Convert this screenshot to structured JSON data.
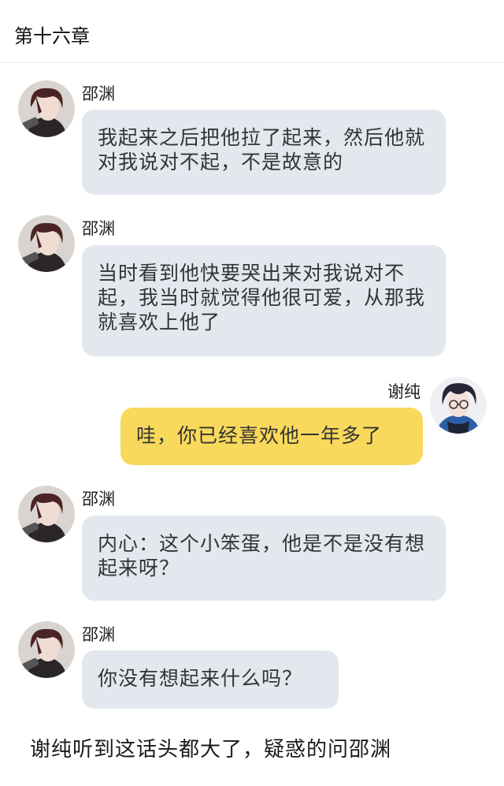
{
  "header": {
    "title": "第十六章"
  },
  "messages": [
    {
      "sender": "邵渊",
      "side": "left",
      "text": "我起来之后把他拉了起来，然后他就对我说对不起，不是故意的"
    },
    {
      "sender": "邵渊",
      "side": "left",
      "text": "当时看到他快要哭出来对我说对不起，我当时就觉得他很可爱，从那我就喜欢上他了"
    },
    {
      "sender": "谢纯",
      "side": "right",
      "text": "哇，你已经喜欢他一年多了"
    },
    {
      "sender": "邵渊",
      "side": "left",
      "text": "内心：这个小笨蛋，他是不是没有想起来呀？"
    },
    {
      "sender": "邵渊",
      "side": "left",
      "text": "你没有想起来什么吗？"
    }
  ],
  "narration": "谢纯听到这话头都大了，疑惑的问邵渊",
  "colors": {
    "left_bubble": "#e3e8ef",
    "right_bubble": "#f9d95b"
  },
  "icons": {
    "left_avatar": "dark-haired-boy-avatar",
    "right_avatar": "glasses-boy-avatar"
  }
}
